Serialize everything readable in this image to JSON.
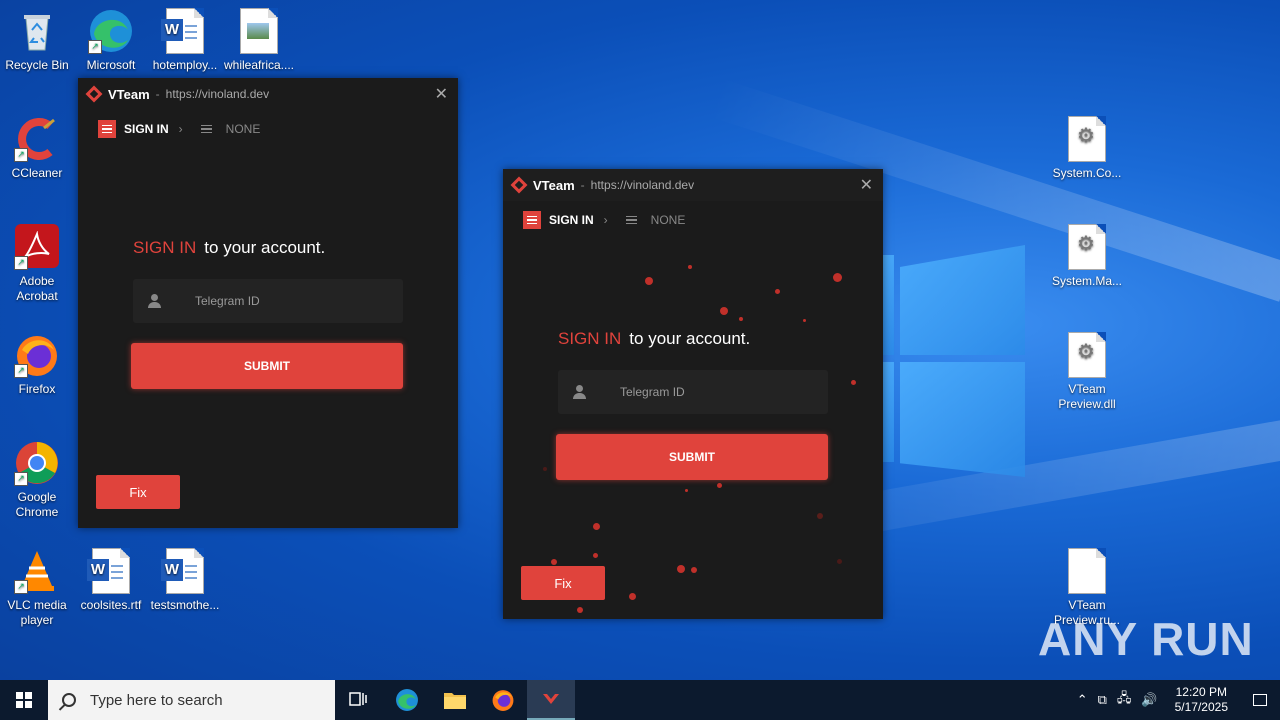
{
  "desktop": {
    "left_icons": [
      {
        "label": "Recycle Bin"
      },
      {
        "label": "Microsoft Edge"
      },
      {
        "label": "hotemploy..."
      },
      {
        "label": "whileafrica...."
      },
      {
        "label": "CCleaner"
      },
      {
        "label": "Adobe Acrobat"
      },
      {
        "label": "Firefox"
      },
      {
        "label": "Google Chrome"
      },
      {
        "label": "VLC media player"
      },
      {
        "label": "coolsites.rtf"
      },
      {
        "label": "testsmothe..."
      }
    ],
    "right_icons": [
      {
        "label": "System.Co..."
      },
      {
        "label": "System.Ma..."
      },
      {
        "label": "VTeam Preview.dll"
      },
      {
        "label": "VTeam Preview.ru..."
      }
    ]
  },
  "windows": [
    {
      "app_name": "VTeam",
      "separator": "-",
      "url": "https://vinoland.dev",
      "nav_signin": "SIGN IN",
      "nav_none": "NONE",
      "heading_red": "SIGN IN",
      "heading_rest": "to your account.",
      "input_placeholder": "Telegram ID",
      "submit_label": "SUBMIT",
      "fix_label": "Fix"
    },
    {
      "app_name": "VTeam",
      "separator": "-",
      "url": "https://vinoland.dev",
      "nav_signin": "SIGN IN",
      "nav_none": "NONE",
      "heading_red": "SIGN IN",
      "heading_rest": "to your account.",
      "input_placeholder": "Telegram ID",
      "submit_label": "SUBMIT",
      "fix_label": "Fix"
    }
  ],
  "taskbar": {
    "search_placeholder": "Type here to search",
    "time": "12:20 PM",
    "date": "5/17/2025"
  },
  "watermark": "ANY RUN",
  "colors": {
    "accent": "#e0433c",
    "window_bg": "#1b1b1b",
    "taskbar_bg": "#0c1a2e"
  }
}
